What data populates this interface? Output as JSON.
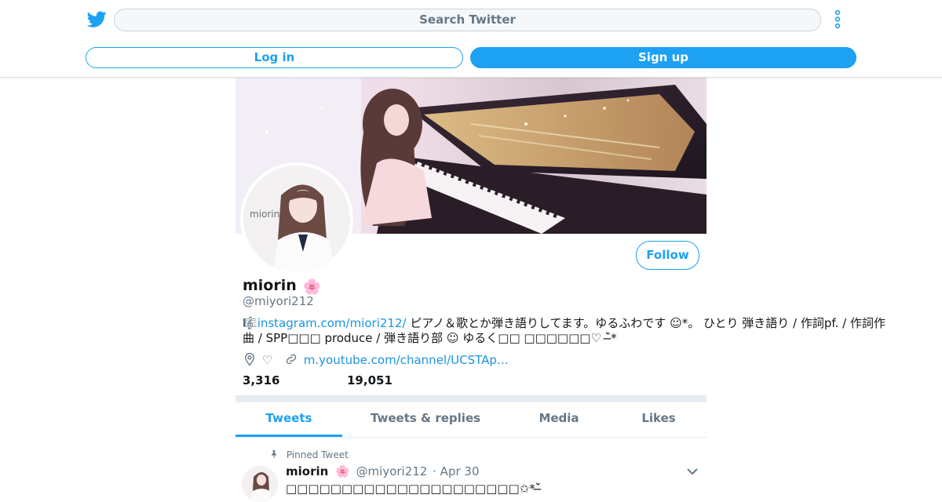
{
  "header": {
    "search_placeholder": "Search Twitter",
    "login_label": "Log in",
    "signup_label": "Sign up"
  },
  "profile": {
    "display_name": "miorin",
    "name_emoji": "🌸",
    "handle": "@miyori212",
    "follow_label": "Follow",
    "bio_prefix": "🎼",
    "bio_link": "instagram.com/miori212/",
    "bio_text": " ピアノ＆歌とか弾き語りしてます。ゆるふわです ☺︎*。 ひとり 弾き語り / 作詞pf. / 作詞作曲 / SPP□□□ produce / 弾き語り部 ☺︎ ゆるく□□ □□□□□□♡ ˘̶̀*",
    "location_text": "♡",
    "website_text": "m.youtube.com/channel/UCSTAp…",
    "stat_1": "3,316",
    "stat_2": "19,051",
    "avatar_watermark": "miorin"
  },
  "tabs": [
    "Tweets",
    "Tweets & replies",
    "Media",
    "Likes"
  ],
  "active_tab": "Tweets",
  "pinned_tweet": {
    "label": "Pinned Tweet",
    "author": "miorin",
    "author_emoji": "🌸",
    "handle": "@miyori212",
    "date": "· Apr 30",
    "text": "□□□□□□□□□□□□□□□□□□□□□✩*˘̶̀"
  },
  "colors": {
    "accent": "#1da1f2",
    "link": "#1b95e0",
    "muted": "#657786",
    "text": "#14171a",
    "divider": "#e6ecf0"
  },
  "icons": [
    "twitter-bird-icon",
    "more-vertical-icon",
    "location-icon",
    "link-icon",
    "pin-icon",
    "chevron-down-icon"
  ]
}
